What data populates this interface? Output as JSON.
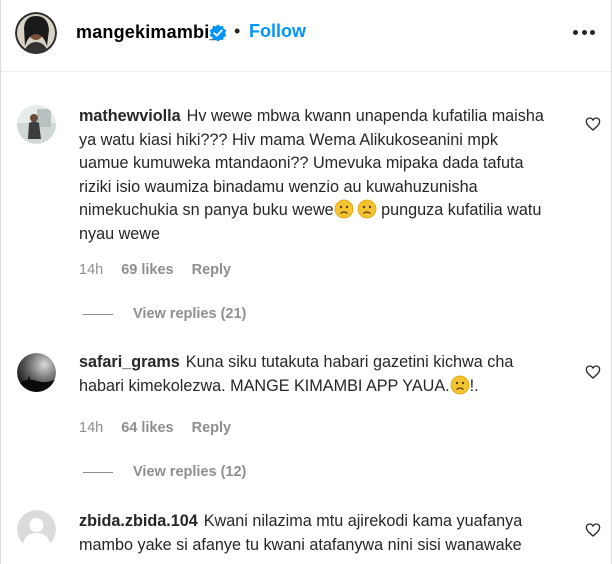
{
  "header": {
    "username": "mangekimambi_",
    "separator": "•",
    "follow_label": "Follow",
    "more_icon": "more-options-icon"
  },
  "comments": [
    {
      "username": "mathewviolla",
      "text_1": "Hv wewe mbwa kwann unapenda kufatilia maisha ya watu kiasi hiki??? Hiv mama Wema Alikukoseanini mpk uamue kumuweka mtandaoni?? Umevuka mipaka dada tafuta riziki isio waumiza binadamu wenzio au kuwahuzunisha nimekuchukia sn panya buku wewe",
      "text_2": " punguza kufatilia watu nyau wewe",
      "time": "14h",
      "likes": "69 likes",
      "reply": "Reply",
      "view_replies": "View replies (21)"
    },
    {
      "username": "safari_grams",
      "text_1": "Kuna siku tutakuta habari gazetini kichwa cha habari kimekolezwa. MANGE KIMAMBI APP YAUA.",
      "text_2": "!.",
      "time": "14h",
      "likes": "64 likes",
      "reply": "Reply",
      "view_replies": "View replies (12)"
    },
    {
      "username": "zbida.zbida.104",
      "text_1": "Kwani nilazima mtu ajirekodi kama yuafanya mambo yake si afanye tu kwani atafanywa nini sisi wanawake"
    }
  ],
  "colors": {
    "follow": "#0095f6",
    "muted": "#8e8e8e",
    "verified": "#0095f6",
    "emoji": "#f4c430"
  }
}
